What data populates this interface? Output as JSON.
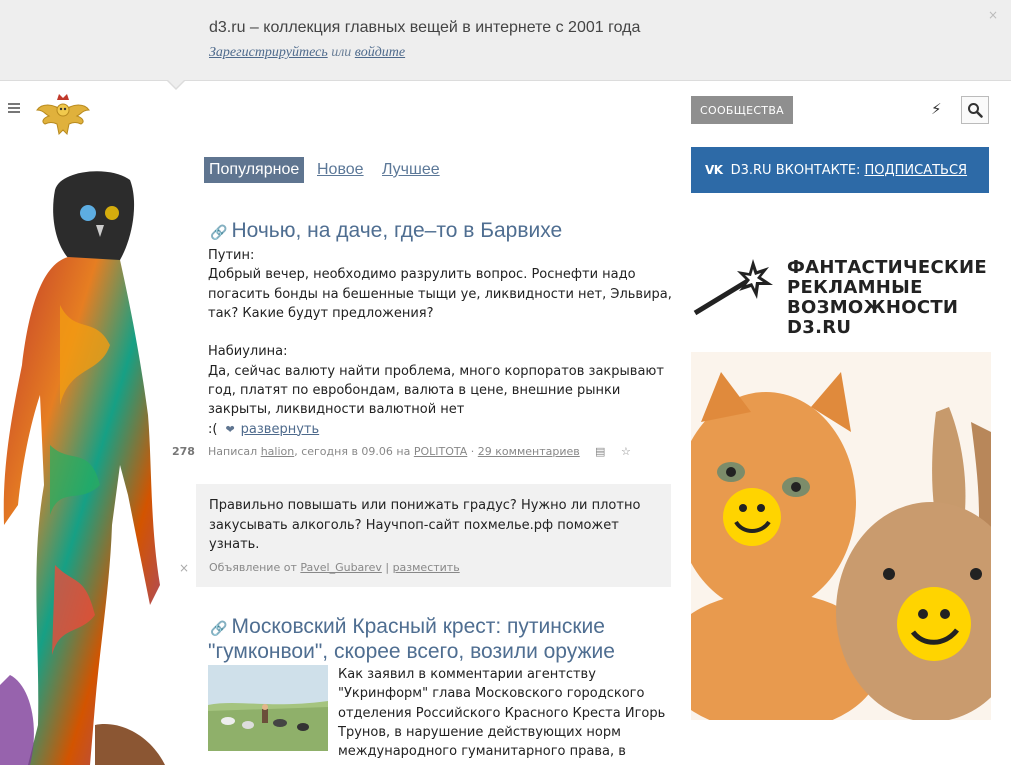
{
  "notice": {
    "text": "d3.ru – коллекция главных вещей в интернете с 2001 года",
    "register": "Зарегистрируйтесь",
    "or": "или",
    "login": "войдите",
    "close": "×"
  },
  "header": {
    "communities": "СООБЩЕСТВА"
  },
  "tabs": {
    "popular": "Популярное",
    "new": "Новое",
    "best": "Лучшее"
  },
  "post1": {
    "title": "Ночью, на даче, где–то в Барвихе",
    "lines": [
      "Путин:",
      "Добрый вечер, необходимо разрулить вопрос. Роснефти надо",
      "погасить бонды на бешенные тыщи уе, ликвидности нет, Эльвира,",
      "так? Какие будут предложения?",
      "",
      "Набиулина:",
      "Да, сейчас валюту найти проблема, много корпоратов закрывают",
      "год, платят по евробондам, валюта в цене, внешние рынки",
      "закрыты, ликвидности валютной нет"
    ],
    "last_line": ":(",
    "expand": "развернуть",
    "score": "278",
    "meta_written": "Написал",
    "author": "halion",
    "meta_date": ", сегодня в 09.06 на",
    "community": "POLITOTA",
    "meta_sep": " · ",
    "comments": "29 комментариев"
  },
  "ad": {
    "lines": [
      "Правильно повышать или понижать градус? Нужно ли плотно",
      "закусывать алкоголь? Научпоп-сайт похмелье.рф поможет",
      "узнать."
    ],
    "footer_prefix": "Объявление от",
    "author": "Pavel_Gubarev",
    "sep": " | ",
    "place": "разместить",
    "close": "×"
  },
  "post2": {
    "title_line1": "Московский Красный крест: путинские",
    "title_line2": "\"гумконвои\", скорее всего, возили оружие",
    "lines": [
      "Как заявил в комментарии агентству",
      "\"Укринформ\" глава Московского городского",
      "отделения Российского Красного Креста Игорь",
      "Трунов, в нарушение действующих норм",
      "международного гуманитарного права, в"
    ]
  },
  "vk": {
    "logo": "VK",
    "label": "D3.RU ВКОНТАКТЕ:",
    "subscribe": "ПОДПИСАТЬСЯ"
  },
  "promo": {
    "line1": "ФАНТАСТИЧЕСКИЕ",
    "line2": "РЕКЛАМНЫЕ",
    "line3": "ВОЗМОЖНОСТИ",
    "line4": "D3.RU"
  },
  "colors": {
    "accent": "#5f7590",
    "link": "#4f6e91",
    "vk": "#2d6aa7"
  }
}
